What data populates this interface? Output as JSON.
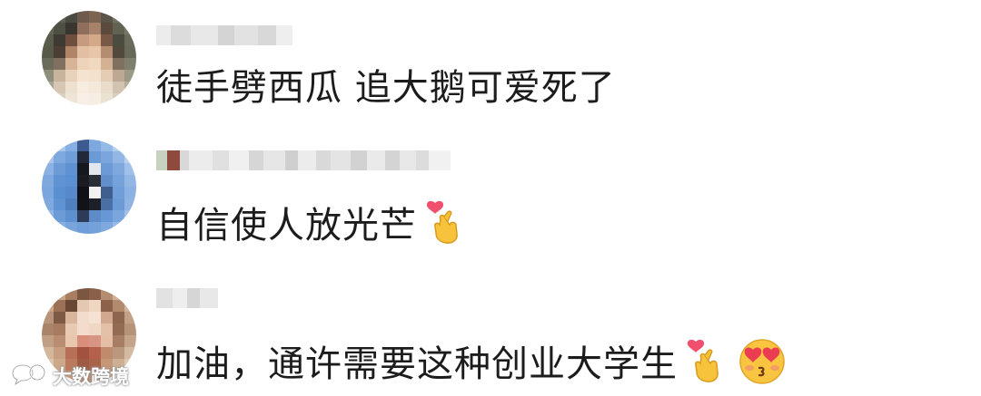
{
  "comments": [
    {
      "username": "",
      "text": "徒手劈西瓜 追大鹅可爱死了",
      "emoji": []
    },
    {
      "username": "",
      "text": "自信使人放光芒",
      "emoji": [
        "finger-heart-emoji"
      ]
    },
    {
      "username": "",
      "text": "加油，通许需要这种创业大学生",
      "emoji": [
        "finger-heart-emoji",
        "heart-eyes-emoji"
      ]
    }
  ],
  "watermark": {
    "text": "大数跨境",
    "icon": "chat-bubbles-icon"
  },
  "colors": {
    "text": "#1c1c1c",
    "background": "#ffffff"
  }
}
